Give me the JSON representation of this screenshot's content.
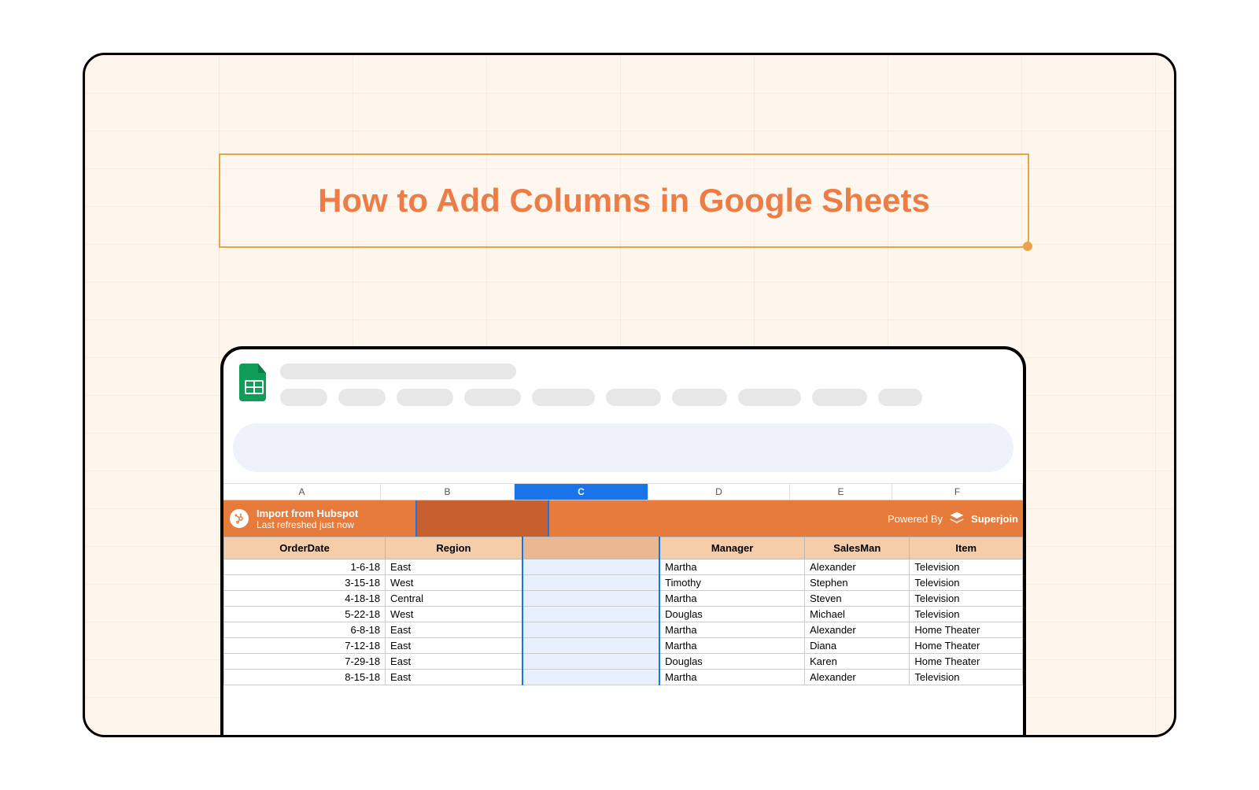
{
  "title": "How to Add Columns in Google Sheets",
  "column_letters": [
    "A",
    "B",
    "C",
    "D",
    "E",
    "F"
  ],
  "selected_column_index": 2,
  "banner": {
    "import_line1": "Import from Hubspot",
    "import_line2": "Last refreshed just now",
    "powered_by": "Powered By",
    "brand": "Superjoin"
  },
  "table": {
    "headers": [
      "OrderDate",
      "Region",
      "",
      "Manager",
      "SalesMan",
      "Item"
    ],
    "rows": [
      {
        "date": "1-6-18",
        "region": "East",
        "manager": "Martha",
        "salesman": "Alexander",
        "item": "Television"
      },
      {
        "date": "3-15-18",
        "region": "West",
        "manager": "Timothy",
        "salesman": "Stephen",
        "item": "Television"
      },
      {
        "date": "4-18-18",
        "region": "Central",
        "manager": "Martha",
        "salesman": "Steven",
        "item": "Television"
      },
      {
        "date": "5-22-18",
        "region": "West",
        "manager": "Douglas",
        "salesman": "Michael",
        "item": "Television"
      },
      {
        "date": "6-8-18",
        "region": "East",
        "manager": "Martha",
        "salesman": "Alexander",
        "item": "Home Theater"
      },
      {
        "date": "7-12-18",
        "region": "East",
        "manager": "Martha",
        "salesman": "Diana",
        "item": "Home Theater"
      },
      {
        "date": "7-29-18",
        "region": "East",
        "manager": "Douglas",
        "salesman": "Karen",
        "item": "Home Theater"
      },
      {
        "date": "8-15-18",
        "region": "East",
        "manager": "Martha",
        "salesman": "Alexander",
        "item": "Television"
      }
    ]
  },
  "skeleton_pill_widths": [
    60,
    60,
    72,
    72,
    80,
    70,
    70,
    80,
    70,
    56
  ]
}
